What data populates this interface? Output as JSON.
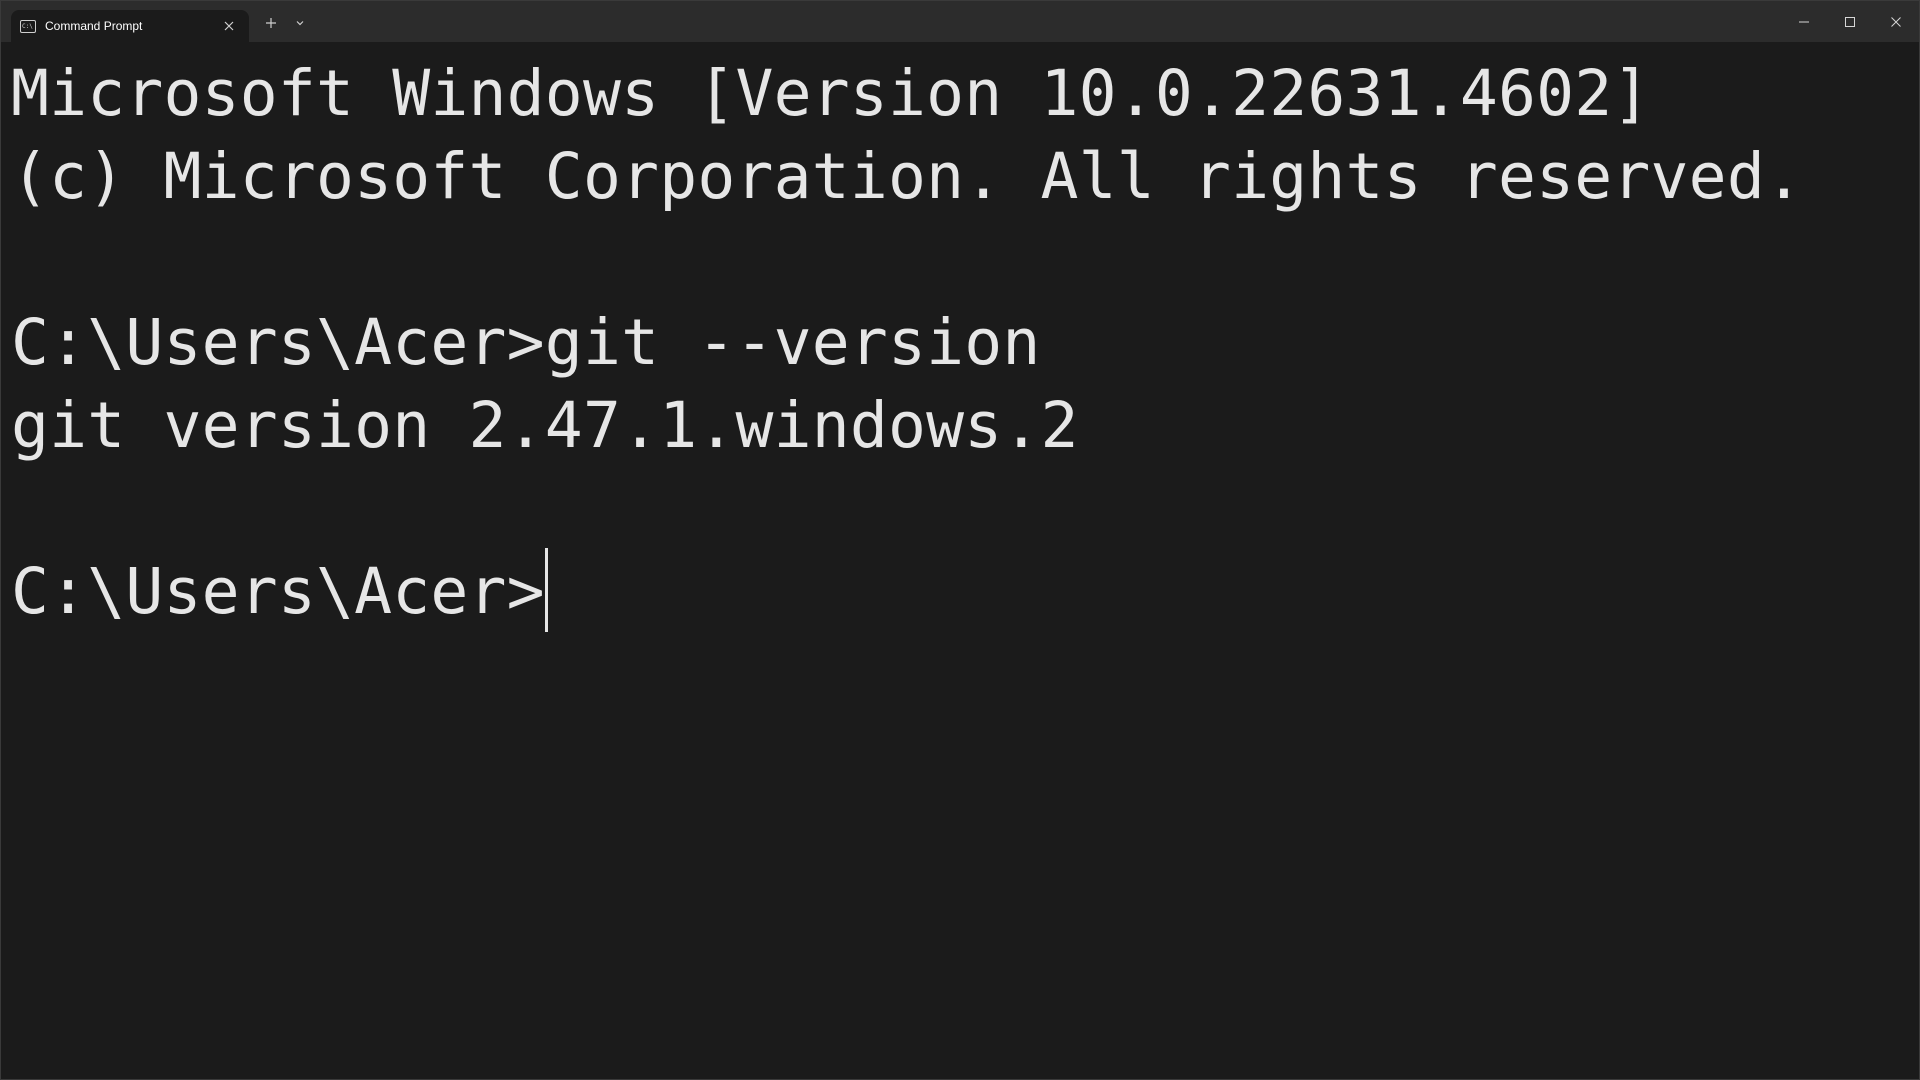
{
  "tab": {
    "title": "Command Prompt",
    "icon": "command-prompt-icon",
    "close_icon": "close-icon"
  },
  "titlebar": {
    "new_tab_icon": "plus-icon",
    "dropdown_icon": "chevron-down-icon",
    "minimize_icon": "minimize-icon",
    "maximize_icon": "maximize-icon",
    "close_icon": "close-icon"
  },
  "terminal": {
    "lines": [
      "Microsoft Windows [Version 10.0.22631.4602]",
      "(c) Microsoft Corporation. All rights reserved.",
      "",
      "C:\\Users\\Acer>git --version",
      "git version 2.47.1.windows.2",
      "",
      "C:\\Users\\Acer>"
    ]
  },
  "colors": {
    "background": "#1b1b1b",
    "titlebar": "#2c2c2c",
    "text": "#e6e6e6"
  }
}
